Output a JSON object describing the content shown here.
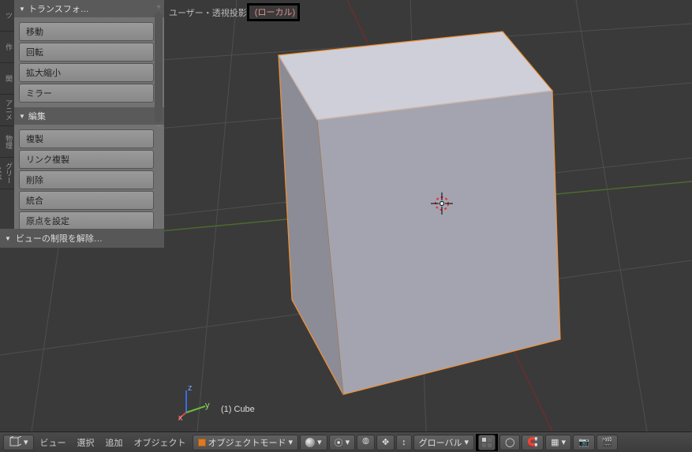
{
  "side_tabs": [
    "ツ",
    "作",
    "関",
    "アニメ",
    "物理",
    "グリースペ"
  ],
  "panel": {
    "transform": {
      "title": "トランスフォ…",
      "translate": "移動",
      "rotate": "回転",
      "scale": "拡大縮小",
      "mirror": "ミラー"
    },
    "edit": {
      "title": "編集",
      "duplicate": "複製",
      "link_duplicate": "リンク複製",
      "delete": "削除",
      "join": "統合",
      "origin": "原点を設定"
    }
  },
  "lower_left": {
    "label": "ビューの制限を解除…"
  },
  "viewport": {
    "label_prefix": "ユーザー・透視投影",
    "label_local": "(ローカル)",
    "object_name": "(1) Cube"
  },
  "header": {
    "view": "ビュー",
    "select": "選択",
    "add": "追加",
    "object": "オブジェクト",
    "mode": "オブジェクトモード",
    "orientation": "グローバル"
  },
  "axes": {
    "x": "x",
    "y": "y",
    "z": "z"
  }
}
